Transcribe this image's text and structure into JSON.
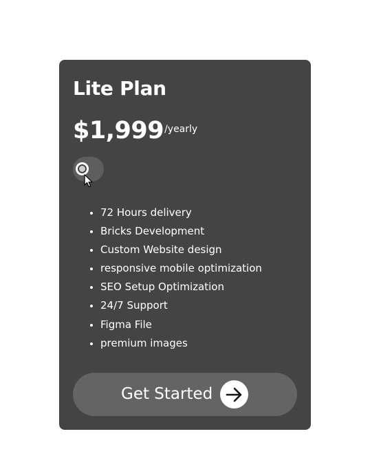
{
  "plan": {
    "name": "Lite Plan",
    "price": "$1,999",
    "period": "/yearly"
  },
  "toggle": {
    "state": "off"
  },
  "features": [
    "72 Hours delivery",
    "Bricks Development",
    "Custom Website design",
    "responsive mobile optimization",
    "SEO Setup Optimization",
    "24/7 Support",
    "Figma File",
    "premium images"
  ],
  "cta": {
    "label": "Get Started",
    "icon": "arrow-right-icon"
  },
  "colors": {
    "card_background": "#444444",
    "toggle_track": "#5e5e5e",
    "cta_background": "#646464",
    "text": "#ffffff"
  }
}
